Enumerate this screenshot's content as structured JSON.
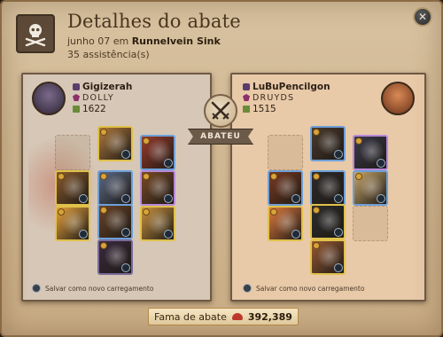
{
  "header": {
    "title": "Detalhes do abate",
    "date_prefix": "junho 07 em",
    "location": "Runnelvein Sink",
    "assists": "35 assistência(s)"
  },
  "center": {
    "result_label": "ABATEU"
  },
  "killer": {
    "name": "Gigizerah",
    "guild": "DOLLY",
    "item_power": "1622",
    "footer": "Salvar como novo carregamento",
    "slots": [
      {
        "name": "bag-slot",
        "empty": true,
        "color": "#bfae9a"
      },
      {
        "name": "head-slot",
        "empty": false,
        "color": "#b07a3c",
        "rarity": "#e0c14a"
      },
      {
        "name": "cape-slot",
        "empty": false,
        "color": "#9a3b2b",
        "rarity": "#6ea0d8"
      },
      {
        "name": "mainhand-slot",
        "empty": false,
        "color": "#8a5a2c",
        "rarity": "#e0c14a"
      },
      {
        "name": "armor-slot",
        "empty": false,
        "color": "#5c6a86",
        "rarity": "#6ea0d8"
      },
      {
        "name": "offhand-slot",
        "empty": false,
        "color": "#7a4a26",
        "rarity": "#b889d9"
      },
      {
        "name": "potion-slot",
        "empty": false,
        "color": "#e8a23c",
        "rarity": "#e0c14a"
      },
      {
        "name": "shoes-slot",
        "empty": false,
        "color": "#6a4428",
        "rarity": "#6ea0d8"
      },
      {
        "name": "food-slot",
        "empty": false,
        "color": "#c9923e",
        "rarity": "#e0c14a"
      },
      {
        "name": "mount-slot",
        "empty": false,
        "color": "#3b2a3e",
        "rarity": "#7a6a9a"
      }
    ]
  },
  "victim": {
    "name": "LuBuPencilgon",
    "guild": "DRUYDS",
    "item_power": "1515",
    "footer": "Salvar como novo carregamento",
    "slots": [
      {
        "name": "bag-slot",
        "empty": true,
        "color": "#c9a684"
      },
      {
        "name": "head-slot",
        "empty": false,
        "color": "#4a3a2c",
        "rarity": "#6ea0d8"
      },
      {
        "name": "cape-slot",
        "empty": false,
        "color": "#3a3a4a",
        "rarity": "#b889d9"
      },
      {
        "name": "mainhand-slot",
        "empty": false,
        "color": "#7a3a22",
        "rarity": "#6ea0d8"
      },
      {
        "name": "armor-slot",
        "empty": false,
        "color": "#2e2a2a",
        "rarity": "#6ea0d8"
      },
      {
        "name": "offhand-slot",
        "empty": false,
        "color": "#c8a66a",
        "rarity": "#6ea0d8"
      },
      {
        "name": "potion-slot",
        "empty": false,
        "color": "#e07a3c",
        "rarity": "#e0c14a"
      },
      {
        "name": "shoes-slot",
        "empty": false,
        "color": "#2c2c2c",
        "rarity": "#e0c14a"
      },
      {
        "name": "food-slot",
        "empty": true,
        "color": "#c9a684"
      },
      {
        "name": "mount-slot",
        "empty": false,
        "color": "#9a5a32",
        "rarity": "#e0c14a"
      }
    ]
  },
  "fame": {
    "label": "Fama de abate",
    "value": "392,389"
  },
  "icons": {
    "close": "close-icon",
    "skull": "skull-crossbones-icon",
    "kill": "crossed-swords-icon"
  }
}
